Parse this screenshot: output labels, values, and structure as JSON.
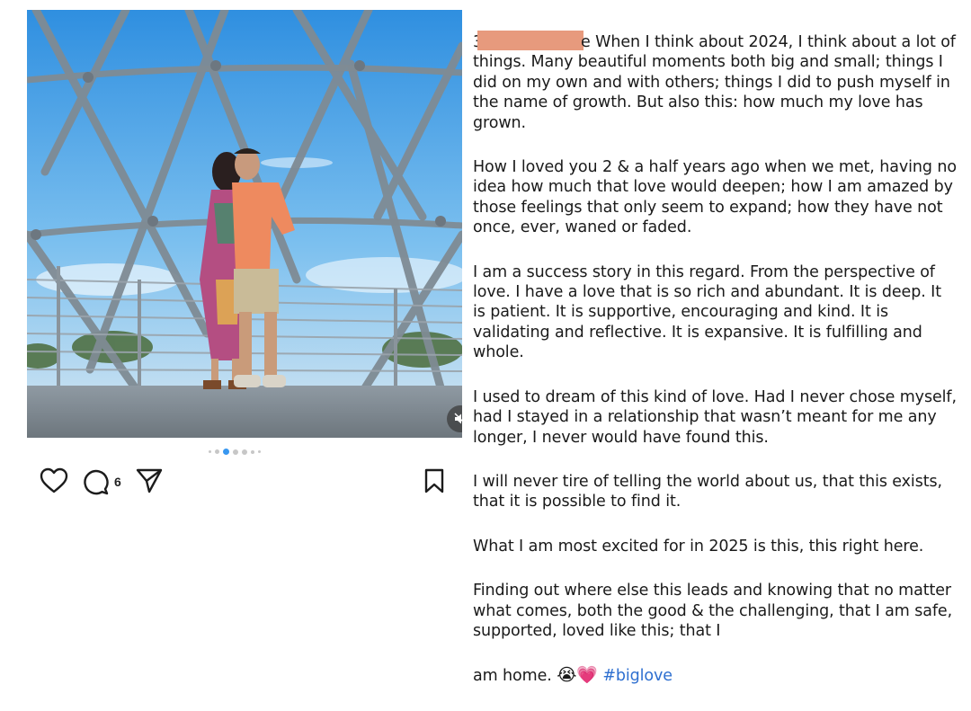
{
  "post": {
    "media_dots": {
      "count": 7,
      "active_index": 2
    },
    "comment_count": "6"
  },
  "caption": {
    "p1_start": "3",
    "p1_text": "e When I think about 2024, I think about a lot of things. Many beautiful moments both big and small; things I did on my own and with others; things I did to push myself in the name of growth. But also this: how much my love has grown.",
    "p2": "How I loved you 2 & a half years ago when we met, having no idea how much that love would deepen; how I am amazed by those feelings that only seem to expand; how they have not once, ever, waned or faded.",
    "p3": "I am a success story in this regard. From the perspective of love. I have a love that is so rich and abundant. It is deep. It is patient. It is supportive, encouraging and kind. It is validating and reflective. It is expansive. It is fulfilling and whole.",
    "p4": "I used to dream of this kind of love. Had I never chose myself, had I stayed in a relationship that wasn’t meant for me any longer, I never would have found this.",
    "p5": "I will never tire of telling the world about us, that this exists, that it is possible to find it.",
    "p6": "What I am most excited for in 2025 is this, this right here.",
    "p7": "Finding out where else this leads and knowing that no matter what comes, both the good & the challenging, that I am safe, supported, loved like this; that I",
    "p8_text": "am home.",
    "p8_emojis": "😭💗",
    "hashtag": "#biglove"
  },
  "icons": {
    "like": "heart-icon",
    "comment": "comment-bubble-icon",
    "share": "paper-plane-icon",
    "save": "bookmark-icon",
    "mute": "muted-speaker-icon"
  },
  "colors": {
    "active_dot": "#3897f0",
    "hashtag": "#2e6fd0",
    "redaction": "#e79a7d"
  }
}
